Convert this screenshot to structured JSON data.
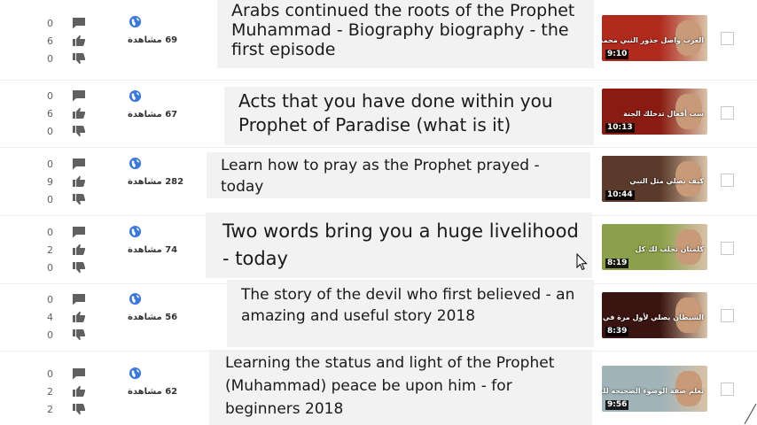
{
  "rows": [
    {
      "comments": "0",
      "likes": "6",
      "dislikes": "0",
      "views": "69 مشاهدة",
      "title": "Arabs continued the roots of the Prophet Muhammad - Biography biography - the first episode",
      "duration": "9:10",
      "thumb_text": "العرب واصل جذور النبي محمد",
      "thumb_color": "#b02a1e"
    },
    {
      "comments": "0",
      "likes": "6",
      "dislikes": "0",
      "views": "67 مشاهدة",
      "title": "Acts that you have done within you Prophet of Paradise (what is it)",
      "duration": "10:13",
      "thumb_text": "ست أفعال تدخلك الجنة",
      "thumb_color": "#8a1b12"
    },
    {
      "comments": "0",
      "likes": "9",
      "dislikes": "0",
      "views": "282 مشاهدة",
      "title": "Learn how to pray as the Prophet prayed - today",
      "duration": "10:44",
      "thumb_text": "كيف تصلي مثل النبي",
      "thumb_color": "#5a3a2a"
    },
    {
      "comments": "0",
      "likes": "2",
      "dislikes": "0",
      "views": "74 مشاهدة",
      "title": "Two words bring you a huge livelihood - today",
      "duration": "8:19",
      "thumb_text": "كلمتان تجلب لك كل",
      "thumb_color": "#8aa04a"
    },
    {
      "comments": "0",
      "likes": "4",
      "dislikes": "0",
      "views": "56 مشاهدة",
      "title": "The story of the devil who first believed - an amazing and useful story 2018",
      "duration": "8:39",
      "thumb_text": "الشيطان يصلي لأول مرة في حياته",
      "thumb_color": "#3a1410"
    },
    {
      "comments": "0",
      "likes": "2",
      "dislikes": "2",
      "views": "62 مشاهدة",
      "title": "Learning the status and light of the Prophet (Muhammad) peace be upon him - for beginners 2018",
      "duration": "9:56",
      "thumb_text": "تعلم صفة الوضوء الصحيحه للمبتدئين",
      "thumb_color": "#9fb3b8"
    }
  ],
  "colors": {
    "icon": "#606060",
    "globe": "#3c78d8",
    "bubble": "#f2f2f2"
  }
}
